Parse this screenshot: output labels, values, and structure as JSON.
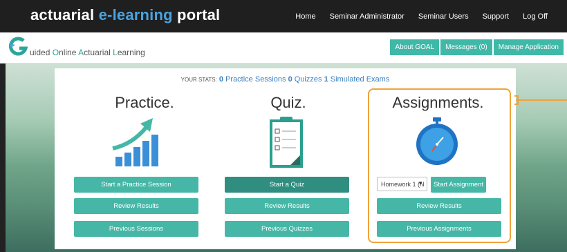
{
  "header": {
    "brand_prefix": "actuarial ",
    "brand_highlight": "e-learning",
    "brand_suffix": " portal",
    "nav": [
      "Home",
      "Seminar Administrator",
      "Seminar Users",
      "Support",
      "Log Off"
    ]
  },
  "subheader": {
    "logo_first": "G",
    "logo_text": [
      {
        "cap": "",
        "rest": "uided "
      },
      {
        "cap": "O",
        "rest": "nline "
      },
      {
        "cap": "A",
        "rest": "ctuarial "
      },
      {
        "cap": "L",
        "rest": "earning"
      }
    ],
    "nav": [
      "About GOAL",
      "Messages (0)",
      "Manage Application"
    ]
  },
  "stats": {
    "label": "YOUR STATS:",
    "practice_count": "0",
    "practice_label": "Practice Sessions",
    "quiz_count": "0",
    "quiz_label": "Quizzes",
    "exam_count": "1",
    "exam_label": "Simulated Exams"
  },
  "practice": {
    "title": "Practice.",
    "start_button": "Start a Practice Session",
    "review_button": "Review Results",
    "previous_button": "Previous Sessions"
  },
  "quiz": {
    "title": "Quiz.",
    "start_button": "Start a Quiz",
    "review_button": "Review Results",
    "previous_button": "Previous Quizzes"
  },
  "assignments": {
    "title": "Assignments.",
    "select_value": "Homework 1 (N",
    "start_button": "Start Assignment",
    "review_button": "Review Results",
    "previous_button": "Previous Assignments"
  },
  "colors": {
    "accent": "#46b7a6",
    "highlight": "#f0a33a",
    "brand_blue": "#4aa3df"
  }
}
